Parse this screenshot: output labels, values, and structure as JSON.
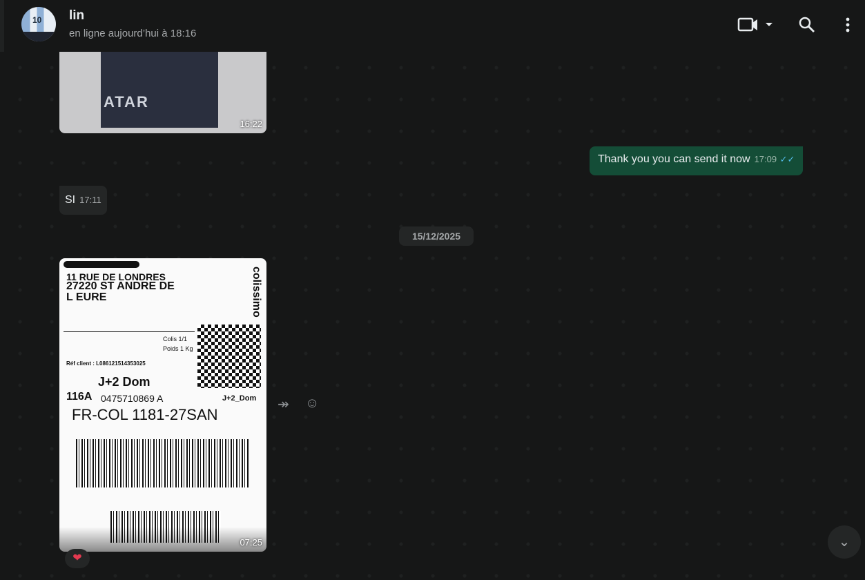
{
  "header": {
    "contact_name": "lin",
    "status": "en ligne aujourd’hui à 18:16",
    "avatar_text": "10"
  },
  "messages": [
    {
      "type": "image",
      "direction": "in",
      "caption_text": "ATAR",
      "time": "16:22"
    },
    {
      "type": "text",
      "direction": "out",
      "text": "Thank you you can send it now",
      "time": "17:09",
      "ticks": "✓✓"
    },
    {
      "type": "text",
      "direction": "in",
      "text": "SI",
      "time": "17:11"
    },
    {
      "type": "date",
      "text": "15/12/2025"
    },
    {
      "type": "image",
      "direction": "in",
      "time": "07:25",
      "reaction": "❤",
      "label": {
        "address1": "11 RUE DE LONDRES",
        "address2": "27220 ST ANDRE DE",
        "address3": "L EURE",
        "carrier": "colissimo",
        "service": "J+2  Dom",
        "code": "116A",
        "tracking": "0475710869 A",
        "service2": "J+2_Dom",
        "route": "FR-COL 1181-27SAN",
        "colis": "Colis 1/1",
        "poids": "Poids 1 Kg",
        "ref": "Réf client : L086121514353025"
      }
    }
  ]
}
